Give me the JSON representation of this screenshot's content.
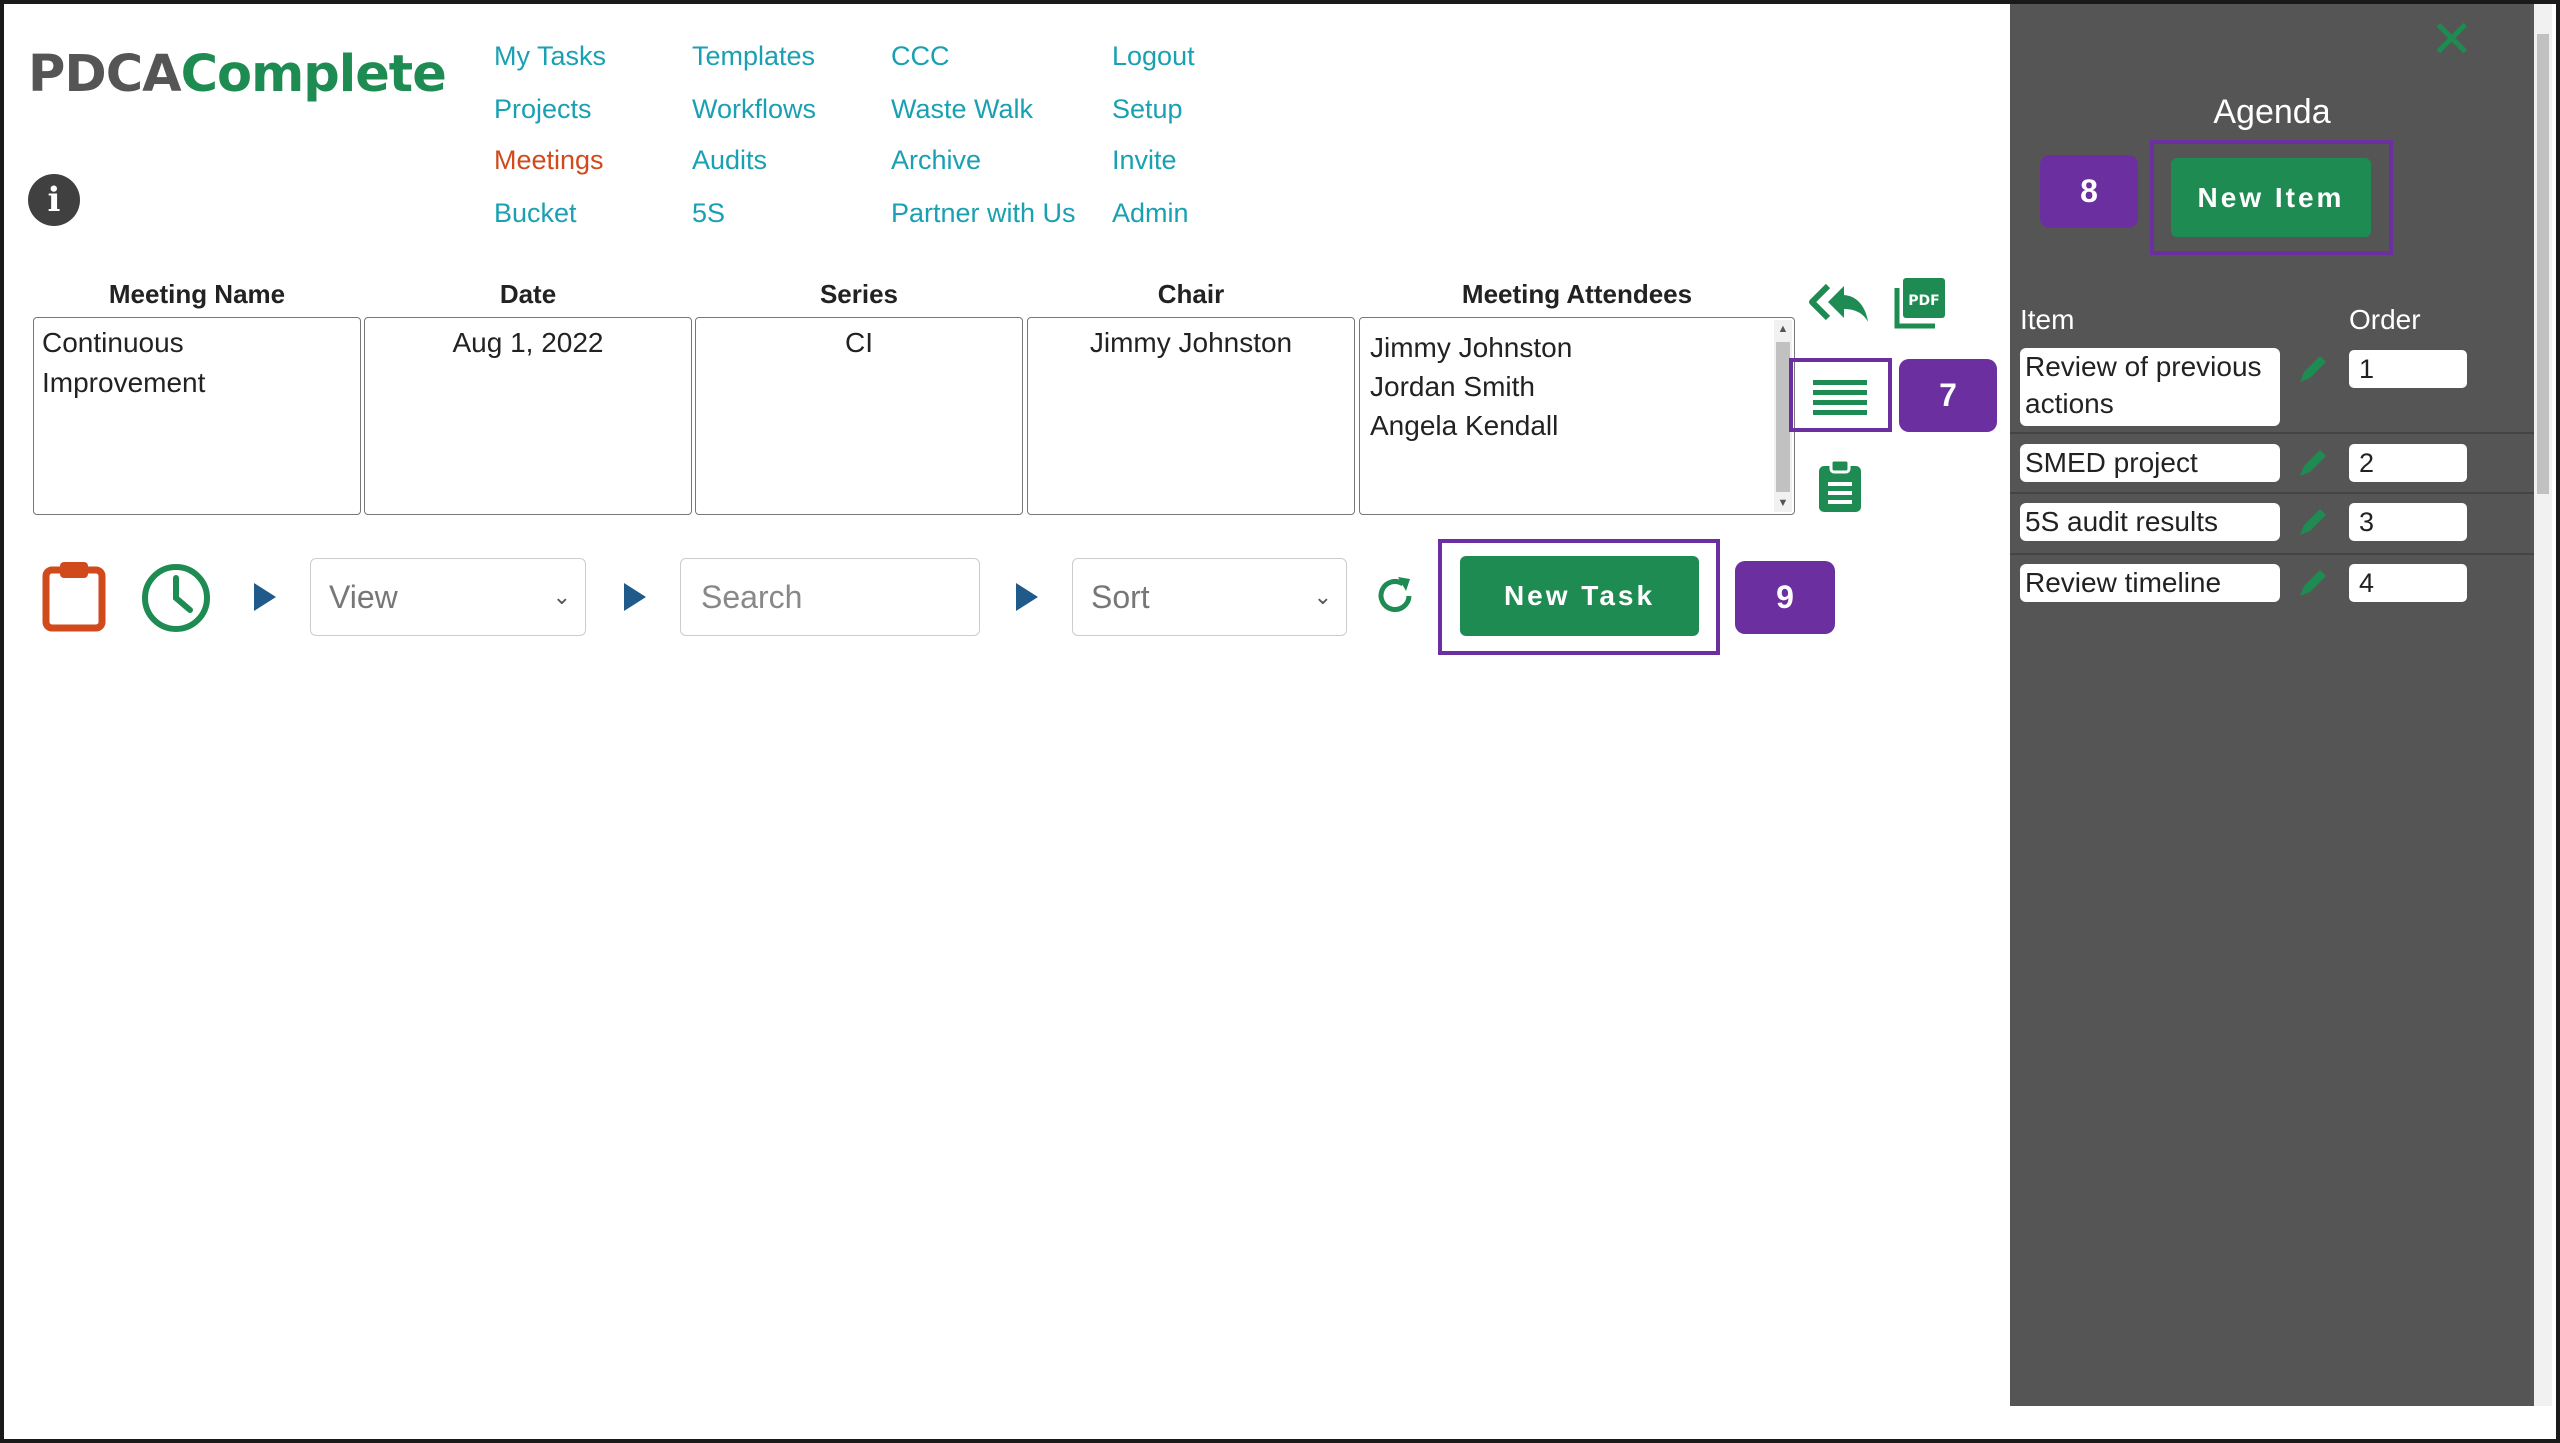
{
  "brand": {
    "logo_part1": "PDCA",
    "logo_part2": "Complete"
  },
  "nav": {
    "col1": [
      "My Tasks",
      "Projects",
      "Meetings",
      "Bucket"
    ],
    "col2": [
      "Templates",
      "Workflows",
      "Audits",
      "5S"
    ],
    "col3": [
      "CCC",
      "Waste Walk",
      "Archive",
      "Partner with Us"
    ],
    "col4": [
      "Logout",
      "Setup",
      "Invite",
      "Admin"
    ],
    "active": "Meetings"
  },
  "meeting": {
    "headers": {
      "name": "Meeting Name",
      "date": "Date",
      "series": "Series",
      "chair": "Chair",
      "attendees": "Meeting Attendees"
    },
    "name": "Continuous Improvement",
    "date": "Aug 1, 2022",
    "series": "CI",
    "chair": "Jimmy Johnston",
    "attendees": [
      "Jimmy Johnston",
      "Jordan Smith",
      "Angela Kendall"
    ]
  },
  "toolbar": {
    "view_placeholder": "View",
    "search_placeholder": "Search",
    "sort_placeholder": "Sort",
    "new_task_label": "New Task"
  },
  "callouts": {
    "list": "7",
    "new_item": "8",
    "new_task": "9"
  },
  "agenda": {
    "title": "Agenda",
    "new_item_label": "New Item",
    "col_item": "Item",
    "col_order": "Order",
    "items": [
      {
        "label": "Review of previous actions",
        "order": "1"
      },
      {
        "label": "SMED project",
        "order": "2"
      },
      {
        "label": "5S audit results",
        "order": "3"
      },
      {
        "label": "Review timeline",
        "order": "4"
      }
    ]
  },
  "colors": {
    "brand_green": "#1e8c52",
    "link_teal": "#1aa0b3",
    "active_orange": "#d04a1c",
    "callout_purple": "#6b2fa0",
    "sidebar_gray": "#555555"
  }
}
